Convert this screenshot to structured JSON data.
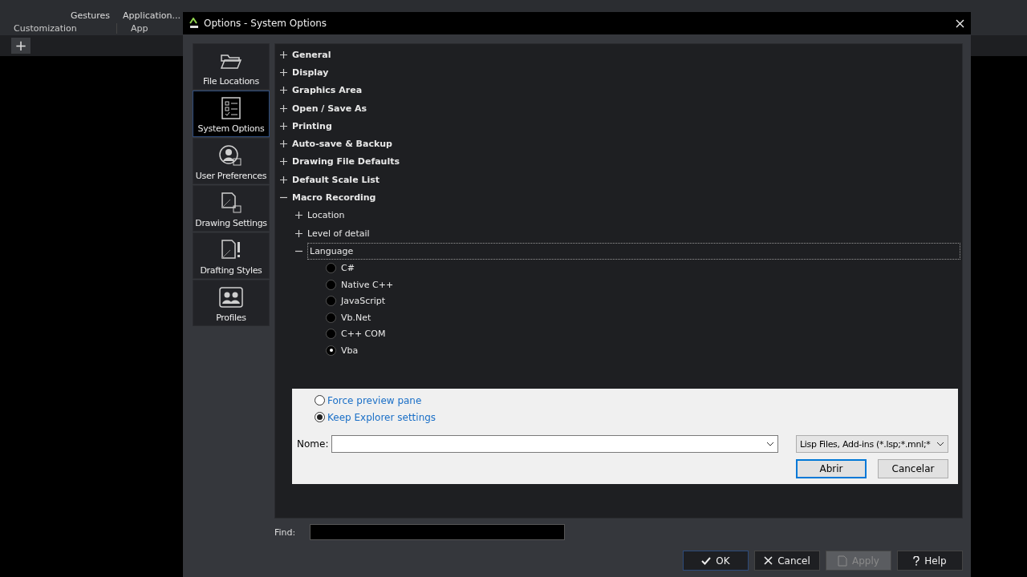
{
  "ribbon": {
    "labels": [
      "Gestures",
      "Application..."
    ],
    "groups": [
      "Customization",
      "App"
    ],
    "new_tab": "+"
  },
  "dialog": {
    "title": "Options - System Options",
    "sidebar": [
      {
        "label": "File Locations",
        "kind": "folder",
        "selected": false
      },
      {
        "label": "System Options",
        "kind": "checklist",
        "selected": true
      },
      {
        "label": "User Preferences",
        "kind": "user",
        "selected": false
      },
      {
        "label": "Drawing Settings",
        "kind": "sheet",
        "selected": false
      },
      {
        "label": "Drafting Styles",
        "kind": "styles",
        "selected": false
      },
      {
        "label": "Profiles",
        "kind": "profiles",
        "selected": false
      }
    ],
    "tree": [
      {
        "label": "General",
        "expanded": false
      },
      {
        "label": "Display",
        "expanded": false
      },
      {
        "label": "Graphics Area",
        "expanded": false
      },
      {
        "label": "Open / Save As",
        "expanded": false
      },
      {
        "label": "Printing",
        "expanded": false
      },
      {
        "label": "Auto-save & Backup",
        "expanded": false
      },
      {
        "label": "Drawing File Defaults",
        "expanded": false
      },
      {
        "label": "Default Scale List",
        "expanded": false
      },
      {
        "label": "Macro Recording",
        "expanded": true,
        "children": [
          {
            "label": "Location",
            "expanded": false
          },
          {
            "label": "Level of detail",
            "expanded": false
          },
          {
            "label": "Language",
            "expanded": true,
            "focused": true,
            "options": [
              {
                "label": "C#",
                "selected": false
              },
              {
                "label": "Native C++",
                "selected": false
              },
              {
                "label": "JavaScript",
                "selected": false
              },
              {
                "label": "Vb.Net",
                "selected": false
              },
              {
                "label": "C++ COM",
                "selected": false
              },
              {
                "label": "Vba",
                "selected": true
              }
            ]
          }
        ]
      }
    ],
    "file_dialog": {
      "view_options": [
        {
          "label": "Force preview pane",
          "selected": false
        },
        {
          "label": "Keep Explorer settings",
          "selected": true
        }
      ],
      "name_label": "Nome:",
      "file_type": "Lisp Files, Add-ins (*.lsp;*.mnl;*",
      "open": "Abrir",
      "cancel": "Cancelar"
    },
    "find_label": "Find:",
    "buttons": [
      {
        "kind": "ok",
        "label": "OK",
        "disabled": false
      },
      {
        "kind": "cancel",
        "label": "Cancel",
        "disabled": false
      },
      {
        "kind": "apply",
        "label": "Apply",
        "disabled": true
      },
      {
        "kind": "help",
        "label": "Help",
        "disabled": false
      }
    ]
  }
}
